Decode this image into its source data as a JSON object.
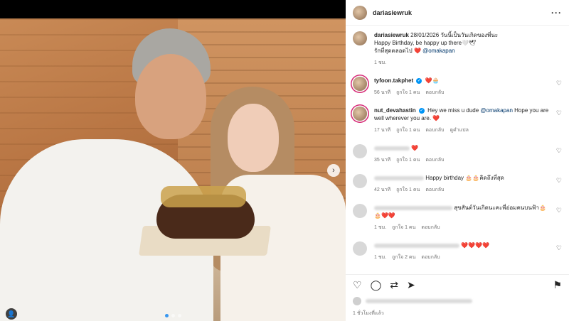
{
  "post": {
    "username": "dariasiewruk",
    "caption_user": "dariasiewruk",
    "caption_line1": "28/01/2026 วันนี้เป็นวันเกิดของพี่นะ",
    "caption_line2": "Happy Birthday, be happy up there🤍🕊",
    "caption_line3": "รักที่สุดตลอดไป",
    "caption_mention": "@omakapan",
    "caption_time": "1 ชม.",
    "posted": "1 ชั่วโมงที่แล้ว"
  },
  "comments": [
    {
      "user": "tyfoon.takphet",
      "verified": true,
      "text": "❤️🧁",
      "time": "56 นาที",
      "likes": "ถูกใจ 1 คน",
      "reply": "ตอบกลับ",
      "extra": ""
    },
    {
      "user": "nut_devahastin",
      "verified": true,
      "text": "Hey we miss u dude",
      "mention": "@omakapan",
      "text2": "Hope you are well wherever you are. ❤️",
      "time": "17 นาที",
      "likes": "ถูกใจ 1 คน",
      "reply": "ตอบกลับ",
      "extra": "ดูคำแปล"
    },
    {
      "user": "",
      "text": "❤️",
      "time": "35 นาที",
      "likes": "ถูกใจ 1 คน",
      "reply": "ตอบกลับ"
    },
    {
      "user": "",
      "text": "Happy birthday 🎂🎂คิดถึงที่สุด",
      "time": "42 นาที",
      "likes": "ถูกใจ 1 คน",
      "reply": "ตอบกลับ"
    },
    {
      "user": "",
      "text": "สุขสันต์วันเกิดนะคะพี่อ่อมคนบนฟ้า🎂🎂❤️❤️",
      "time": "1 ชม.",
      "likes": "ถูกใจ 1 คน",
      "reply": "ตอบกลับ"
    },
    {
      "user": "",
      "text": "❤️❤️❤️❤️",
      "time": "1 ชม.",
      "likes": "ถูกใจ 2 คน",
      "reply": "ตอบกลับ"
    }
  ],
  "icons": {
    "more": "more-icon",
    "heart": "heart-icon",
    "comment": "comment-icon",
    "share": "share-icon",
    "send": "send-icon",
    "bookmark": "bookmark-icon"
  },
  "colors": {
    "accent": "#0095f6",
    "like_red": "#ed4956",
    "mention": "#00376b"
  }
}
